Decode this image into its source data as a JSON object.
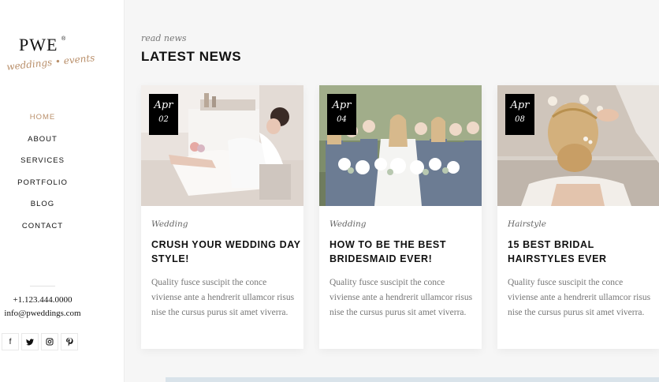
{
  "logo": {
    "main": "PWE",
    "registered": "®",
    "tagline": "weddings • events"
  },
  "nav": {
    "items": [
      {
        "label": "HOME",
        "active": true
      },
      {
        "label": "ABOUT"
      },
      {
        "label": "SERVICES"
      },
      {
        "label": "PORTFOLIO"
      },
      {
        "label": "BLOG"
      },
      {
        "label": "CONTACT"
      }
    ]
  },
  "contact": {
    "phone": "+1.123.444.0000",
    "email": "info@pweddings.com"
  },
  "socials": [
    {
      "icon": "facebook-icon",
      "glyph": "f"
    },
    {
      "icon": "twitter-icon",
      "glyph": "🐦"
    },
    {
      "icon": "instagram-icon",
      "glyph": "◎"
    },
    {
      "icon": "pinterest-icon",
      "glyph": "𝒑"
    }
  ],
  "section": {
    "script": "read news",
    "title": "LATEST NEWS"
  },
  "posts": [
    {
      "month": "Apr",
      "day": "02",
      "category": "Wedding",
      "title": "CRUSH YOUR WEDDING DAY STYLE!",
      "excerpt": "Quality fusce suscipit the conce viviense ante a hendrerit ullamcor risus nise the cursus purus sit amet viverra."
    },
    {
      "month": "Apr",
      "day": "04",
      "category": "Wedding",
      "title": "HOW TO BE THE BEST BRIDESMAID EVER!",
      "excerpt": "Quality fusce suscipit the conce viviense ante a hendrerit ullamcor risus nise the cursus purus sit amet viverra."
    },
    {
      "month": "Apr",
      "day": "08",
      "category": "Hairstyle",
      "title": "15 BEST BRIDAL HAIRSTYLES EVER",
      "excerpt": "Quality fusce suscipit the conce viviense ante a hendrerit ullamcor risus nise the cursus purus sit amet viverra."
    }
  ]
}
